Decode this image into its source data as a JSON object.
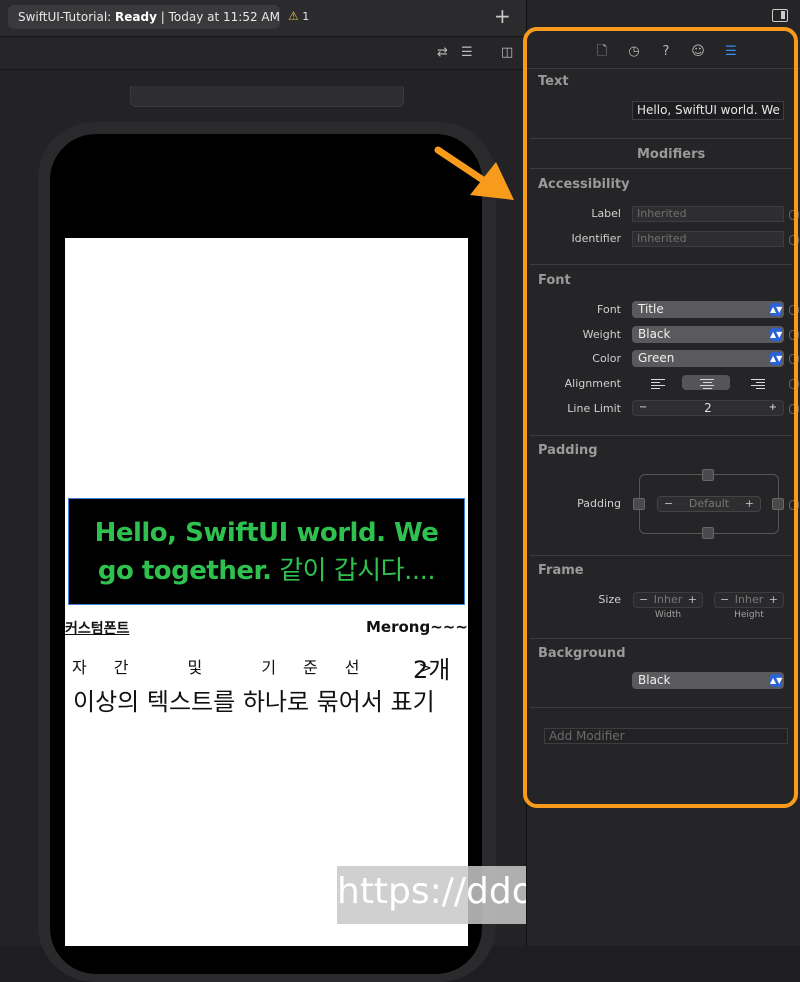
{
  "toolbar": {
    "project": "SwiftUI-Tutorial:",
    "state": "Ready",
    "time": "| Today at 11:52 AM",
    "warning_count": "1",
    "add_label": "+"
  },
  "preview": {
    "hello_line1": "Hello, SwiftUI world. We",
    "hello_line2_en": "go together.",
    "hello_line2_kr": " 같이 갑시다....",
    "custom_font_text": "커스텀폰트",
    "merong_text": "Merong~~~",
    "spaced_text": "자간 및 기준선 >",
    "spaced_suffix": "2개",
    "multiline_text": "이상의 텍스트를 하나로 묶어서 표기",
    "text_color": "#2fc14f"
  },
  "watermark": "https://ddolcat.tistory.com",
  "inspector": {
    "accent": "#f89b1c",
    "text_section": "Text",
    "text_value": "Hello, SwiftUI world. We g",
    "modifiers_title": "Modifiers",
    "accessibility": {
      "title": "Accessibility",
      "label_label": "Label",
      "label_placeholder": "Inherited",
      "identifier_label": "Identifier",
      "identifier_placeholder": "Inherited"
    },
    "font": {
      "title": "Font",
      "font_label": "Font",
      "font_value": "Title",
      "weight_label": "Weight",
      "weight_value": "Black",
      "color_label": "Color",
      "color_value": "Green",
      "alignment_label": "Alignment",
      "alignment_selected": "center",
      "line_limit_label": "Line Limit",
      "line_limit_value": "2"
    },
    "padding": {
      "title": "Padding",
      "label": "Padding",
      "value": "Default"
    },
    "frame": {
      "title": "Frame",
      "size_label": "Size",
      "width_placeholder": "Inher",
      "height_placeholder": "Inher",
      "width_caption": "Width",
      "height_caption": "Height"
    },
    "background": {
      "title": "Background",
      "value": "Black"
    },
    "add_modifier_placeholder": "Add Modifier"
  }
}
